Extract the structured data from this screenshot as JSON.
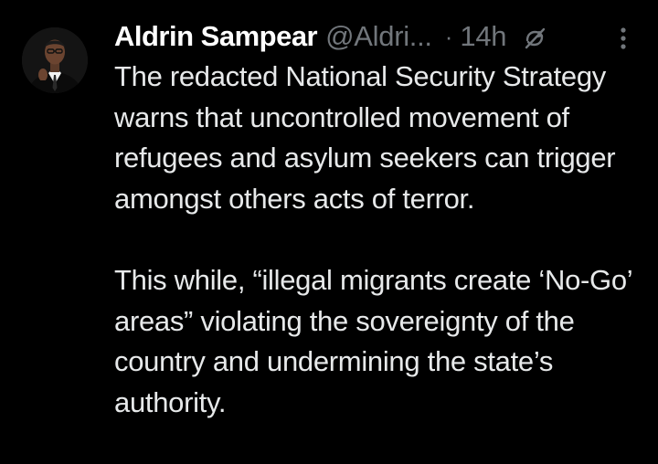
{
  "tweet": {
    "author_name": "Aldrin Sampear",
    "handle": "@Aldri...",
    "separator": "·",
    "time": "14h",
    "paragraphs": [
      "The redacted National Security Strategy warns that uncontrolled movement of refugees and asylum seekers can trigger amongst others acts of terror.",
      "This while, “illegal migrants create ‘No-Go’ areas” violating the sovereignty of the country and undermining the state’s authority."
    ],
    "icons": {
      "status": "no-sync-icon",
      "more": "more-vertical-icon"
    }
  },
  "colors": {
    "background": "#000000",
    "text": "#e7e9ea",
    "secondary": "#71767b"
  }
}
